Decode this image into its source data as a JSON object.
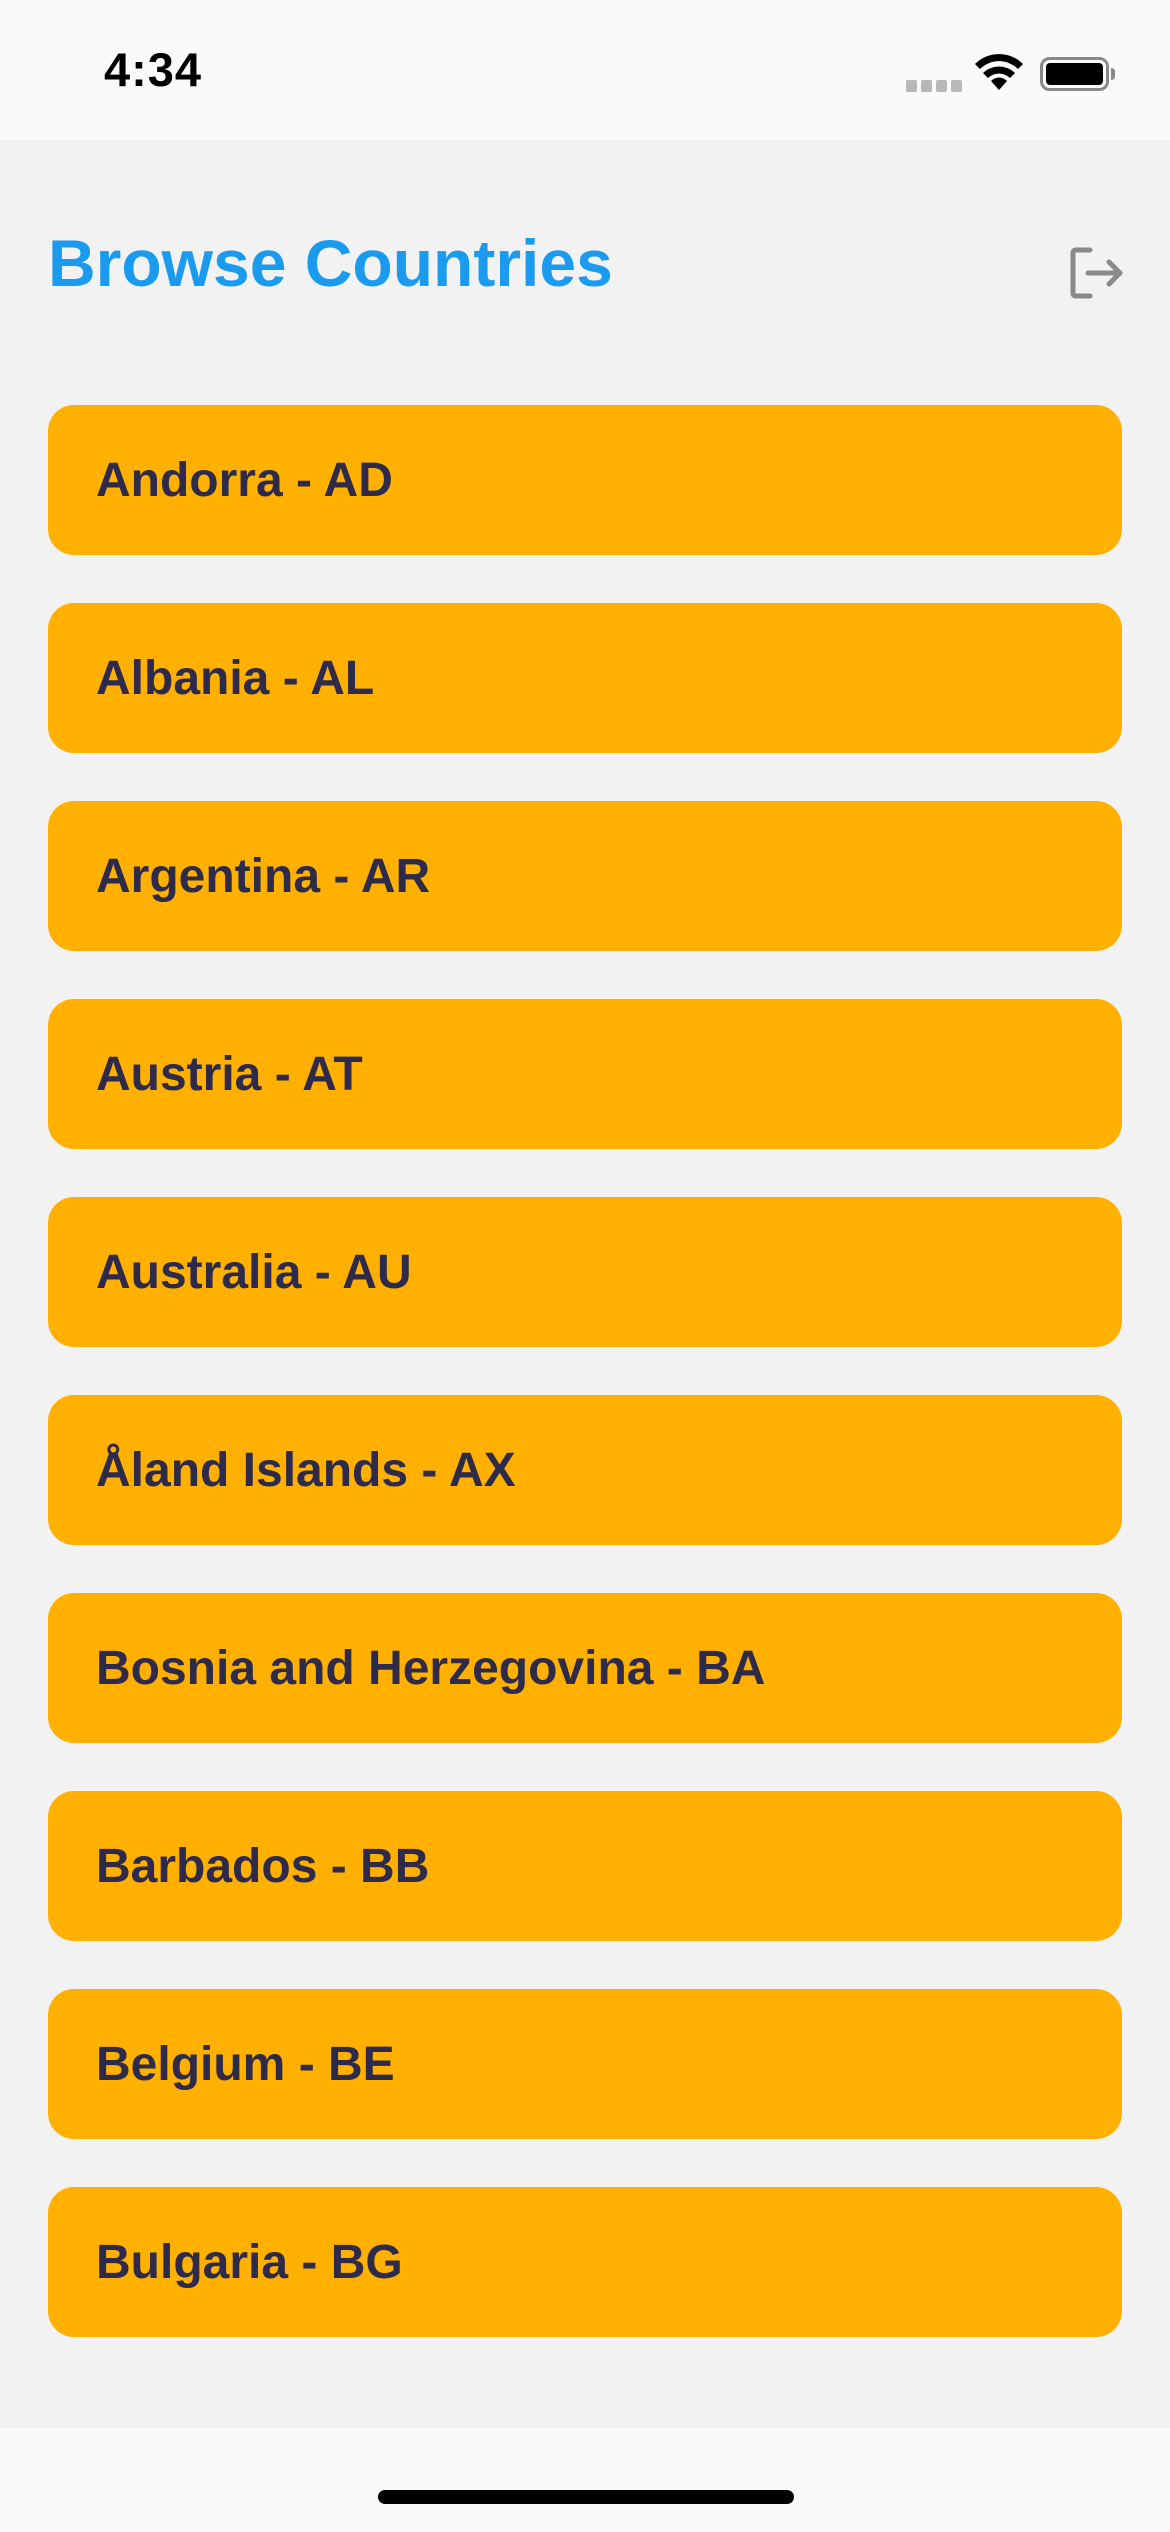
{
  "status_bar": {
    "time": "4:34"
  },
  "header": {
    "title": "Browse Countries",
    "logout_icon": "logout-icon"
  },
  "colors": {
    "title": "#1a9bf0",
    "item_background": "#ffb000",
    "item_text": "#2d2a4a",
    "content_background": "#f2f2f2"
  },
  "countries": [
    {
      "label": "Andorra - AD"
    },
    {
      "label": "Albania - AL"
    },
    {
      "label": "Argentina - AR"
    },
    {
      "label": "Austria - AT"
    },
    {
      "label": "Australia - AU"
    },
    {
      "label": "Åland Islands - AX"
    },
    {
      "label": "Bosnia and Herzegovina - BA"
    },
    {
      "label": "Barbados - BB"
    },
    {
      "label": "Belgium - BE"
    },
    {
      "label": "Bulgaria - BG"
    }
  ]
}
